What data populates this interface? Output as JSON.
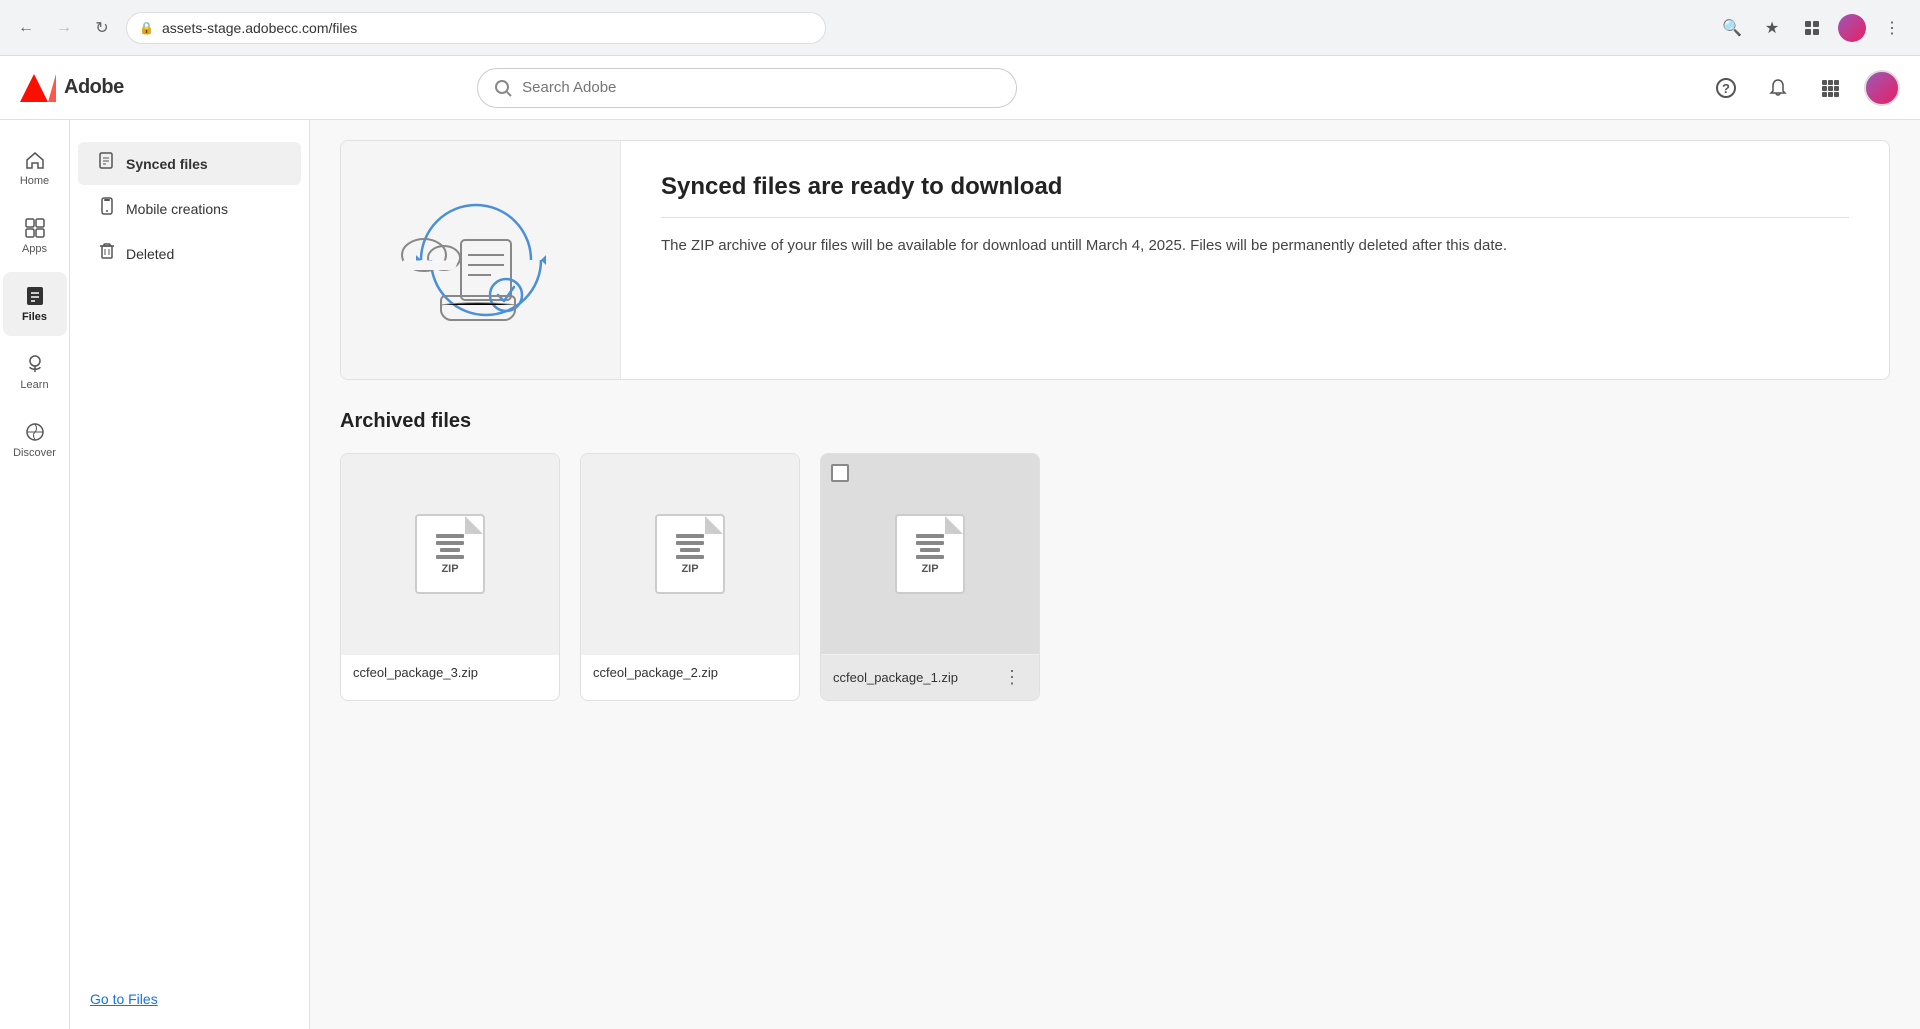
{
  "browser": {
    "url": "assets-stage.adobecc.com/files",
    "back_disabled": true,
    "forward_disabled": true
  },
  "header": {
    "logo_text": "Adobe",
    "search_placeholder": "Search Adobe",
    "search_value": ""
  },
  "left_nav": {
    "items": [
      {
        "id": "home",
        "label": "Home",
        "icon": "home"
      },
      {
        "id": "apps",
        "label": "Apps",
        "icon": "grid"
      },
      {
        "id": "files",
        "label": "Files",
        "icon": "files",
        "active": true
      },
      {
        "id": "learn",
        "label": "Learn",
        "icon": "learn"
      },
      {
        "id": "discover",
        "label": "Discover",
        "icon": "discover"
      }
    ]
  },
  "content_sidebar": {
    "items": [
      {
        "id": "synced-files",
        "label": "Synced files",
        "icon": "doc",
        "active": true
      },
      {
        "id": "mobile-creations",
        "label": "Mobile creations",
        "icon": "mobile"
      },
      {
        "id": "deleted",
        "label": "Deleted",
        "icon": "trash"
      }
    ],
    "bottom_link": "Go to Files"
  },
  "banner": {
    "title": "Synced files are ready to download",
    "description": "The ZIP archive of your files will be available for download untill March 4, 2025. Files will be permanently deleted after this date."
  },
  "archived_section": {
    "title": "Archived files",
    "files": [
      {
        "id": 1,
        "name": "ccfeol_package_3.zip",
        "has_checkbox": false,
        "has_more": false
      },
      {
        "id": 2,
        "name": "ccfeol_package_2.zip",
        "has_checkbox": false,
        "has_more": false
      },
      {
        "id": 3,
        "name": "ccfeol_package_1.zip",
        "has_checkbox": true,
        "has_more": true
      }
    ]
  }
}
